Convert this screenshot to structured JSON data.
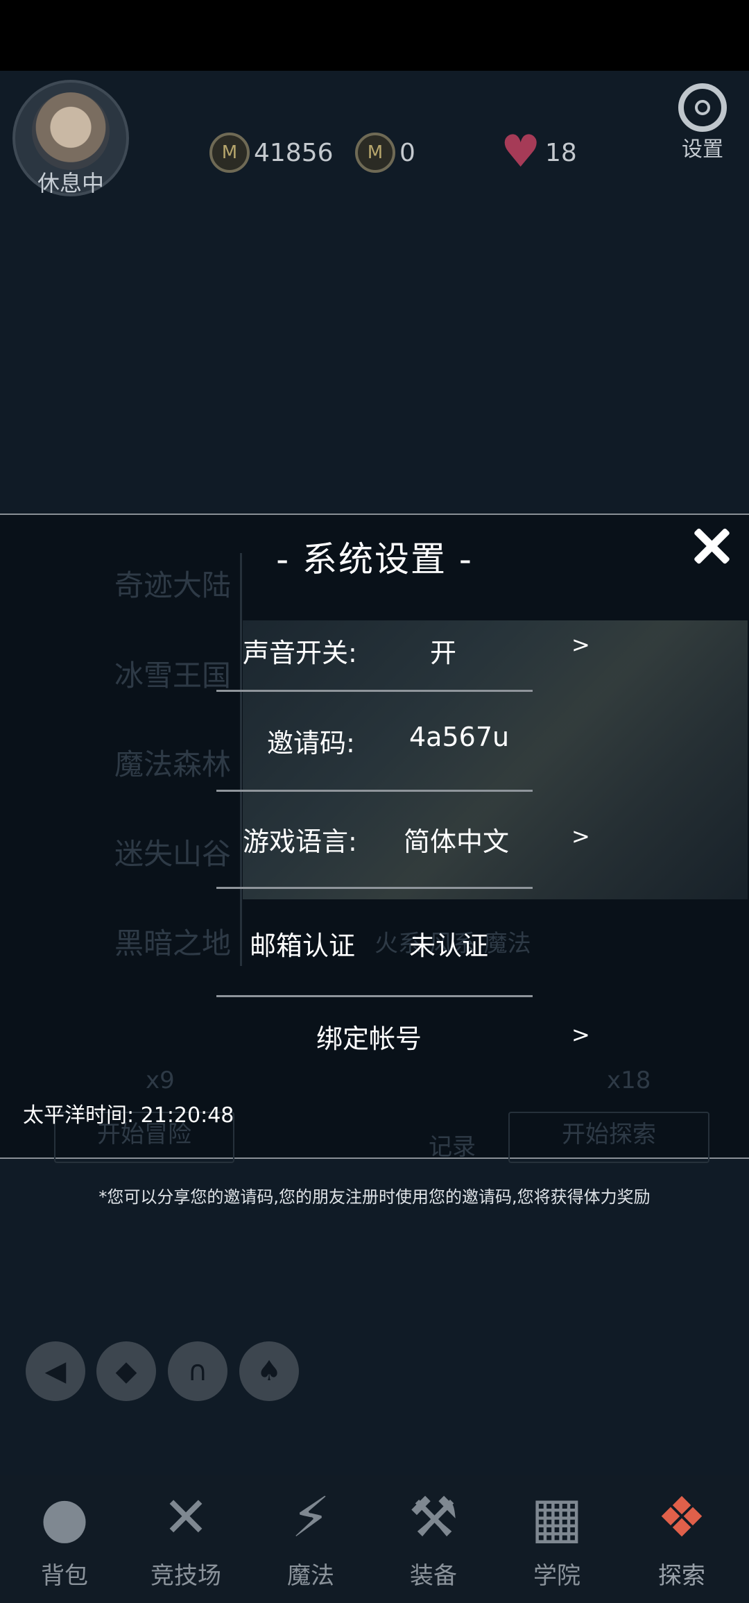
{
  "header": {
    "avatar_status": "休息中",
    "currencies": [
      {
        "icon": "m-coin-icon",
        "value": "41856"
      },
      {
        "icon": "m-coin-icon",
        "value": "0"
      }
    ],
    "stamina": {
      "icon": "heart-icon",
      "value": "18"
    },
    "settings_label": "设置"
  },
  "modal": {
    "title": "- 系统设置 -",
    "rows": [
      {
        "label": "声音开关:",
        "value": "开",
        "arrow": ">"
      },
      {
        "label": "邀请码:",
        "value": "4a567u"
      },
      {
        "label": "游戏语言:",
        "value": "简体中文",
        "arrow": ">"
      },
      {
        "label": "邮箱认证",
        "value": "未认证"
      },
      {
        "label": "绑定帐号",
        "arrow": ">"
      }
    ],
    "pacific_time": "太平洋时间: 21:20:48"
  },
  "background": {
    "regions": [
      "奇迹大陆",
      "冰雪王国",
      "魔法森林",
      "迷失山谷",
      "黑暗之地"
    ],
    "element_tags": "火系 风系 魔法",
    "cost_left": "x9",
    "cost_right": "x18",
    "start_adventure": "开始冒险",
    "record": "记录",
    "start_explore": "开始探索"
  },
  "tip": "*您可以分享您的邀请码,您的朋友注册时使用您的邀请码,您将获得体力奖励",
  "round_buttons": [
    "back-icon",
    "crystal-icon",
    "helmet-icon",
    "spade-icon"
  ],
  "bottom_nav": [
    {
      "label": "背包",
      "icon": "backpack-icon"
    },
    {
      "label": "竞技场",
      "icon": "crossed-swords-icon"
    },
    {
      "label": "魔法",
      "icon": "lightning-icon"
    },
    {
      "label": "装备",
      "icon": "hammer-icon"
    },
    {
      "label": "学院",
      "icon": "book-icon"
    },
    {
      "label": "探索",
      "icon": "compass-icon"
    }
  ],
  "colors": {
    "accent": "#e0604a",
    "modal_bg": "#091119",
    "page_bg": "#101b26"
  }
}
